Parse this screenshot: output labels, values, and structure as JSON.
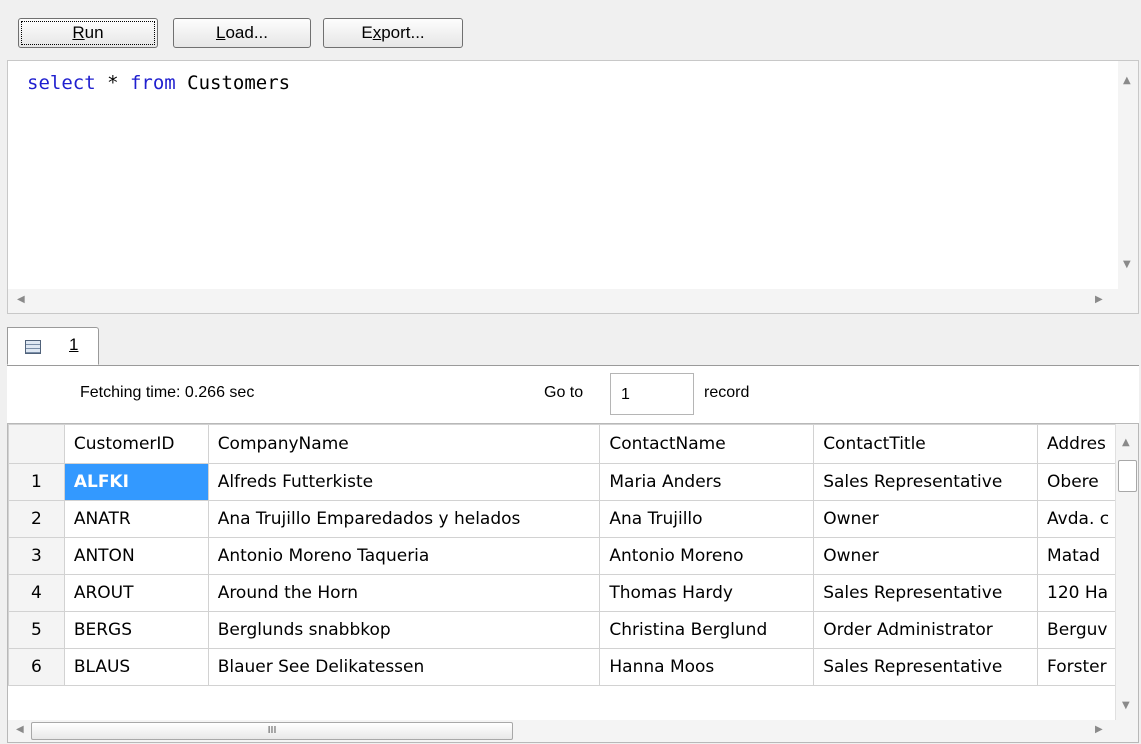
{
  "toolbar": {
    "run": {
      "pre": "",
      "u": "R",
      "post": "un"
    },
    "load": {
      "pre": "",
      "u": "L",
      "post": "oad..."
    },
    "export": {
      "pre": "E",
      "u": "x",
      "post": "port..."
    }
  },
  "editor": {
    "tokens": [
      {
        "text": "select",
        "kind": "keyword"
      },
      {
        "text": " * ",
        "kind": "plain"
      },
      {
        "text": "from",
        "kind": "keyword"
      },
      {
        "text": " Customers",
        "kind": "plain"
      }
    ]
  },
  "result_tab": {
    "label": "1",
    "icon": "grid-table-icon"
  },
  "infobar": {
    "fetching_time": "Fetching time: 0.266 sec",
    "goto_label": "Go to",
    "goto_value": "1",
    "record_label": "record"
  },
  "grid": {
    "columns": [
      "CustomerID",
      "CompanyName",
      "ContactName",
      "ContactTitle",
      "Addres"
    ],
    "rows": [
      {
        "num": "1",
        "cells": [
          "ALFKI",
          "Alfreds Futterkiste",
          "Maria Anders",
          "Sales Representative",
          "Obere"
        ]
      },
      {
        "num": "2",
        "cells": [
          "ANATR",
          "Ana Trujillo Emparedados y helados",
          "Ana Trujillo",
          "Owner",
          "Avda. c"
        ]
      },
      {
        "num": "3",
        "cells": [
          "ANTON",
          "Antonio Moreno Taqueria",
          "Antonio Moreno",
          "Owner",
          "Matad"
        ]
      },
      {
        "num": "4",
        "cells": [
          "AROUT",
          "Around the Horn",
          "Thomas Hardy",
          "Sales Representative",
          "120 Ha"
        ]
      },
      {
        "num": "5",
        "cells": [
          "BERGS",
          "Berglunds snabbkop",
          "Christina Berglund",
          "Order Administrator",
          "Berguv"
        ]
      },
      {
        "num": "6",
        "cells": [
          "BLAUS",
          "Blauer See Delikatessen",
          "Hanna Moos",
          "Sales Representative",
          "Forster"
        ]
      }
    ],
    "scroll_grip": "III"
  },
  "colors": {
    "keyword": "#1f1fcf",
    "selection": "#3399ff"
  }
}
